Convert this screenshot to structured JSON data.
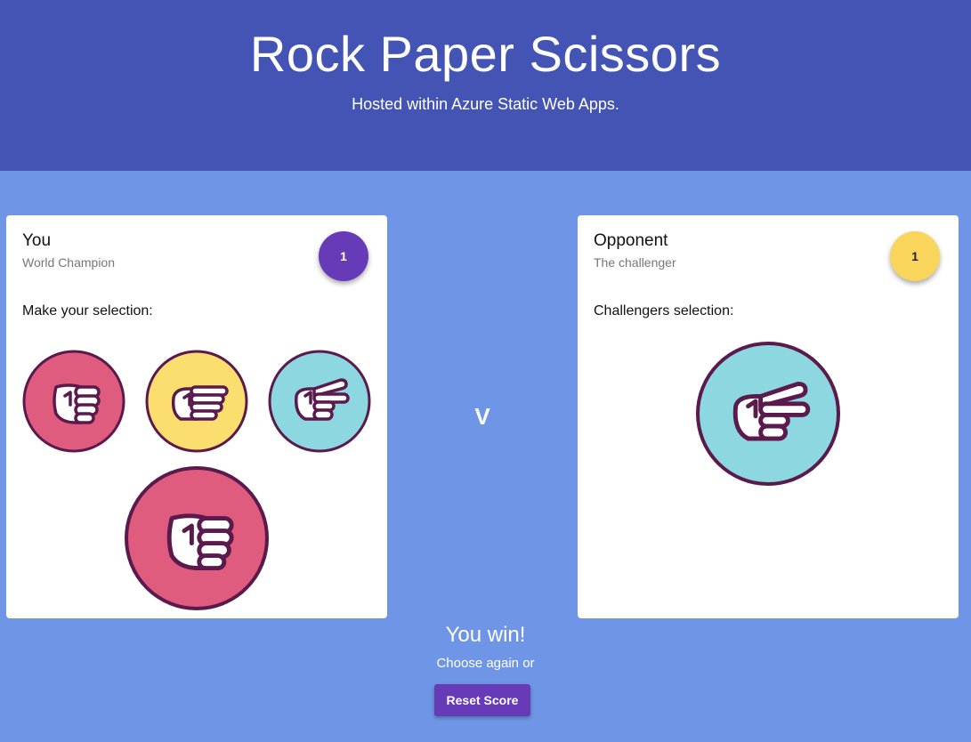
{
  "header": {
    "title": "Rock Paper Scissors",
    "subtitle": "Hosted within Azure Static Web Apps."
  },
  "player": {
    "name": "You",
    "subtitle": "World Champion",
    "score": "1",
    "prompt": "Make your selection:",
    "choices": [
      {
        "name": "rock",
        "color": "#e05c7e"
      },
      {
        "name": "paper",
        "color": "#fbde6e"
      },
      {
        "name": "scissors",
        "color": "#8dd7e0"
      }
    ],
    "selected": {
      "name": "rock",
      "color": "#e05c7e"
    }
  },
  "opponent": {
    "name": "Opponent",
    "subtitle": "The challenger",
    "score": "1",
    "prompt": "Challengers selection:",
    "selected": {
      "name": "scissors",
      "color": "#8dd7e0"
    }
  },
  "versus": "V",
  "result": {
    "title": "You win!",
    "again": "Choose again or",
    "reset_label": "Reset Score"
  },
  "colors": {
    "header_bg": "#4454b4",
    "page_bg": "#6f96e6",
    "accent": "#673ab7",
    "opponent_accent": "#f9d65b",
    "outline": "#5a1a4c"
  }
}
